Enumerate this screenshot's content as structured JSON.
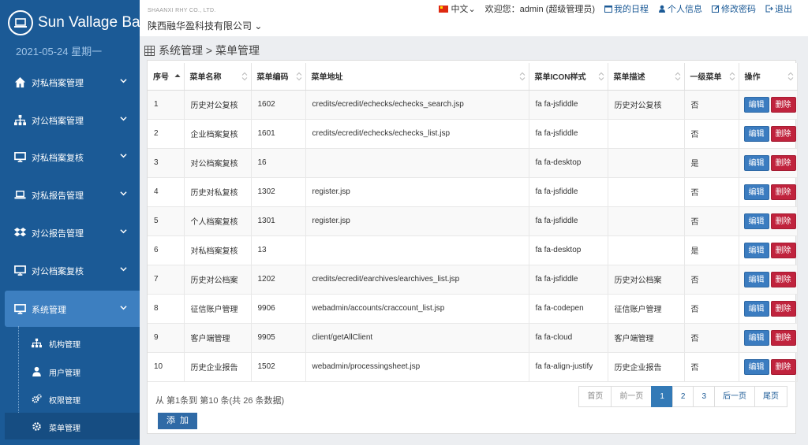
{
  "brand": {
    "name": "Sun Vallage Bank",
    "date": "2021-05-24 星期一"
  },
  "sidebar": {
    "items": [
      {
        "label": "对私档案管理",
        "icon": "home-icon"
      },
      {
        "label": "对公档案管理",
        "icon": "sitemap-icon"
      },
      {
        "label": "对私档案复核",
        "icon": "desktop-icon"
      },
      {
        "label": "对私报告管理",
        "icon": "laptop-icon"
      },
      {
        "label": "对公报告管理",
        "icon": "dropbox-icon"
      },
      {
        "label": "对公档案复核",
        "icon": "desktop-icon"
      },
      {
        "label": "系统管理",
        "icon": "desktop-icon",
        "active": true
      }
    ],
    "subitems": [
      {
        "label": "机构管理",
        "icon": "sitemap-icon"
      },
      {
        "label": "用户管理",
        "icon": "user-icon"
      },
      {
        "label": "权限管理",
        "icon": "cogs-icon"
      },
      {
        "label": "菜单管理",
        "icon": "gear-icon",
        "active": true
      }
    ]
  },
  "topbar": {
    "company_small": "SHAANXI RHY CO., LTD.",
    "company_name": "陕西融华盈科技有限公司",
    "language": "中文",
    "welcome": "欢迎您：admin (超级管理员)",
    "schedule": "我的日程",
    "profile": "个人信息",
    "change_password": "修改密码",
    "logout": "退出"
  },
  "breadcrumb": "系统管理 > 菜单管理",
  "table": {
    "headers": [
      "序号",
      "菜单名称",
      "菜单编码",
      "菜单地址",
      "菜单ICON样式",
      "菜单描述",
      "一级菜单",
      "操作"
    ],
    "rows": [
      [
        "1",
        "历史对公复核",
        "1602",
        "credits/ecredit/echecks/echecks_search.jsp",
        "fa fa-jsfiddle",
        "历史对公复核",
        "否"
      ],
      [
        "2",
        "企业档案复核",
        "1601",
        "credits/ecredit/echecks/echecks_list.jsp",
        "fa fa-jsfiddle",
        "",
        "否"
      ],
      [
        "3",
        "对公档案复核",
        "16",
        "",
        "fa fa-desktop",
        "",
        "是"
      ],
      [
        "4",
        "历史对私复核",
        "1302",
        "register.jsp",
        "fa fa-jsfiddle",
        "",
        "否"
      ],
      [
        "5",
        "个人档案复核",
        "1301",
        "register.jsp",
        "fa fa-jsfiddle",
        "",
        "否"
      ],
      [
        "6",
        "对私档案复核",
        "13",
        "",
        "fa fa-desktop",
        "",
        "是"
      ],
      [
        "7",
        "历史对公档案",
        "1202",
        "credits/ecredit/earchives/earchives_list.jsp",
        "fa fa-jsfiddle",
        "历史对公档案",
        "否"
      ],
      [
        "8",
        "征信账户管理",
        "9906",
        "webadmin/accounts/craccount_list.jsp",
        "fa fa-codepen",
        "征信账户管理",
        "否"
      ],
      [
        "9",
        "客户端管理",
        "9905",
        "client/getAllClient",
        "fa fa-cloud",
        "客户端管理",
        "否"
      ],
      [
        "10",
        "历史企业报告",
        "1502",
        "webadmin/processingsheet.jsp",
        "fa fa-align-justify",
        "历史企业报告",
        "否"
      ]
    ],
    "edit_label": "编辑",
    "delete_label": "删除"
  },
  "pagination": {
    "info": "从 第1条到 第10 条(共 26 条数据)",
    "first": "首页",
    "prev": "前一页",
    "pages": [
      "1",
      "2",
      "3"
    ],
    "next": "后一页",
    "last": "尾页"
  },
  "add_button": "添加",
  "colors": {
    "sidebar": "#1b5a96",
    "active": "#3d7fc0",
    "edit": "#3b7cc0",
    "delete": "#c0233d"
  }
}
